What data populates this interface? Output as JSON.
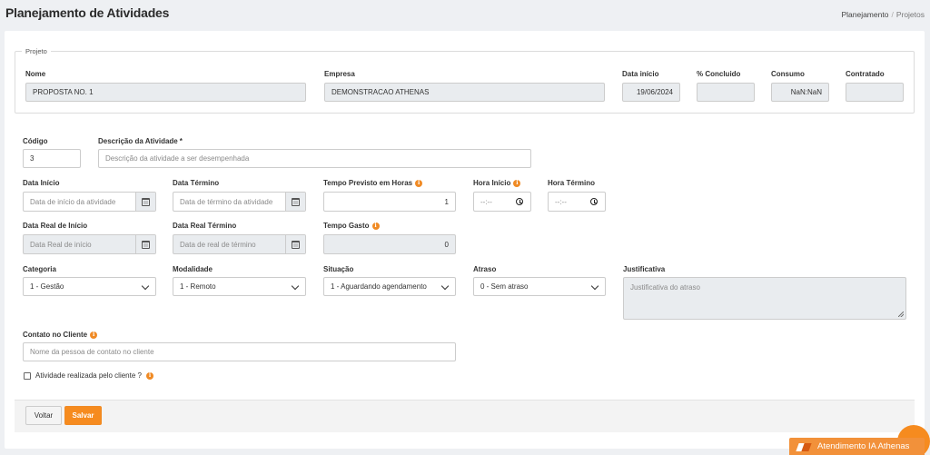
{
  "page": {
    "title": "Planejamento de Atividades",
    "breadcrumb": [
      "Planejamento",
      "Projetos"
    ]
  },
  "projeto": {
    "legend": "Projeto",
    "nome": {
      "label": "Nome",
      "value": "PROPOSTA NO. 1"
    },
    "empresa": {
      "label": "Empresa",
      "value": "DEMONSTRACAO ATHENAS"
    },
    "data_inicio": {
      "label": "Data início",
      "value": "19/06/2024"
    },
    "concluido": {
      "label": "% Concluido",
      "value": ""
    },
    "consumo": {
      "label": "Consumo",
      "value": "NaN:NaN"
    },
    "contratado": {
      "label": "Contratado",
      "value": ""
    }
  },
  "form": {
    "codigo": {
      "label": "Código",
      "value": "3"
    },
    "descricao": {
      "label": "Descrição da Atividade",
      "required": "*",
      "placeholder": "Descrição da atividade a ser desempenhada"
    },
    "data_inicio": {
      "label": "Data Início",
      "placeholder": "Data de início da atividade"
    },
    "data_termino": {
      "label": "Data Término",
      "placeholder": "Data de término da atividade"
    },
    "tempo_previsto": {
      "label": "Tempo Previsto em Horas",
      "value": "1"
    },
    "hora_inicio": {
      "label": "Hora Início",
      "value": "--:--"
    },
    "hora_termino": {
      "label": "Hora Término",
      "value": "--:--"
    },
    "data_real_inicio": {
      "label": "Data Real de Início",
      "placeholder": "Data Real de início"
    },
    "data_real_termino": {
      "label": "Data Real Término",
      "placeholder": "Data de real de término"
    },
    "tempo_gasto": {
      "label": "Tempo Gasto",
      "value": "0"
    },
    "categoria": {
      "label": "Categoria",
      "value": "1 - Gestão"
    },
    "modalidade": {
      "label": "Modalidade",
      "value": "1 - Remoto"
    },
    "situacao": {
      "label": "Situação",
      "value": "1 - Aguardando agendamento"
    },
    "atraso": {
      "label": "Atraso",
      "value": "0 - Sem atraso"
    },
    "justificativa": {
      "label": "Justificativa",
      "placeholder": "Justificativa do atraso"
    },
    "contato": {
      "label": "Contato no Cliente",
      "placeholder": "Nome da pessoa de contato no cliente"
    },
    "realizada_cliente": {
      "label": "Atividade realizada pelo cliente ?",
      "checked": false
    }
  },
  "actions": {
    "voltar": "Voltar",
    "salvar": "Salvar"
  },
  "chat": {
    "label": "Atendimento IA Athenas"
  },
  "colors": {
    "accent": "#f68b1f",
    "background": "#eef0f3",
    "readonly": "#e9ecef"
  },
  "icons": {
    "info": "info-circle-icon",
    "calendar": "calendar-icon",
    "clock": "clock-icon",
    "select": "chevron-down-icon"
  }
}
